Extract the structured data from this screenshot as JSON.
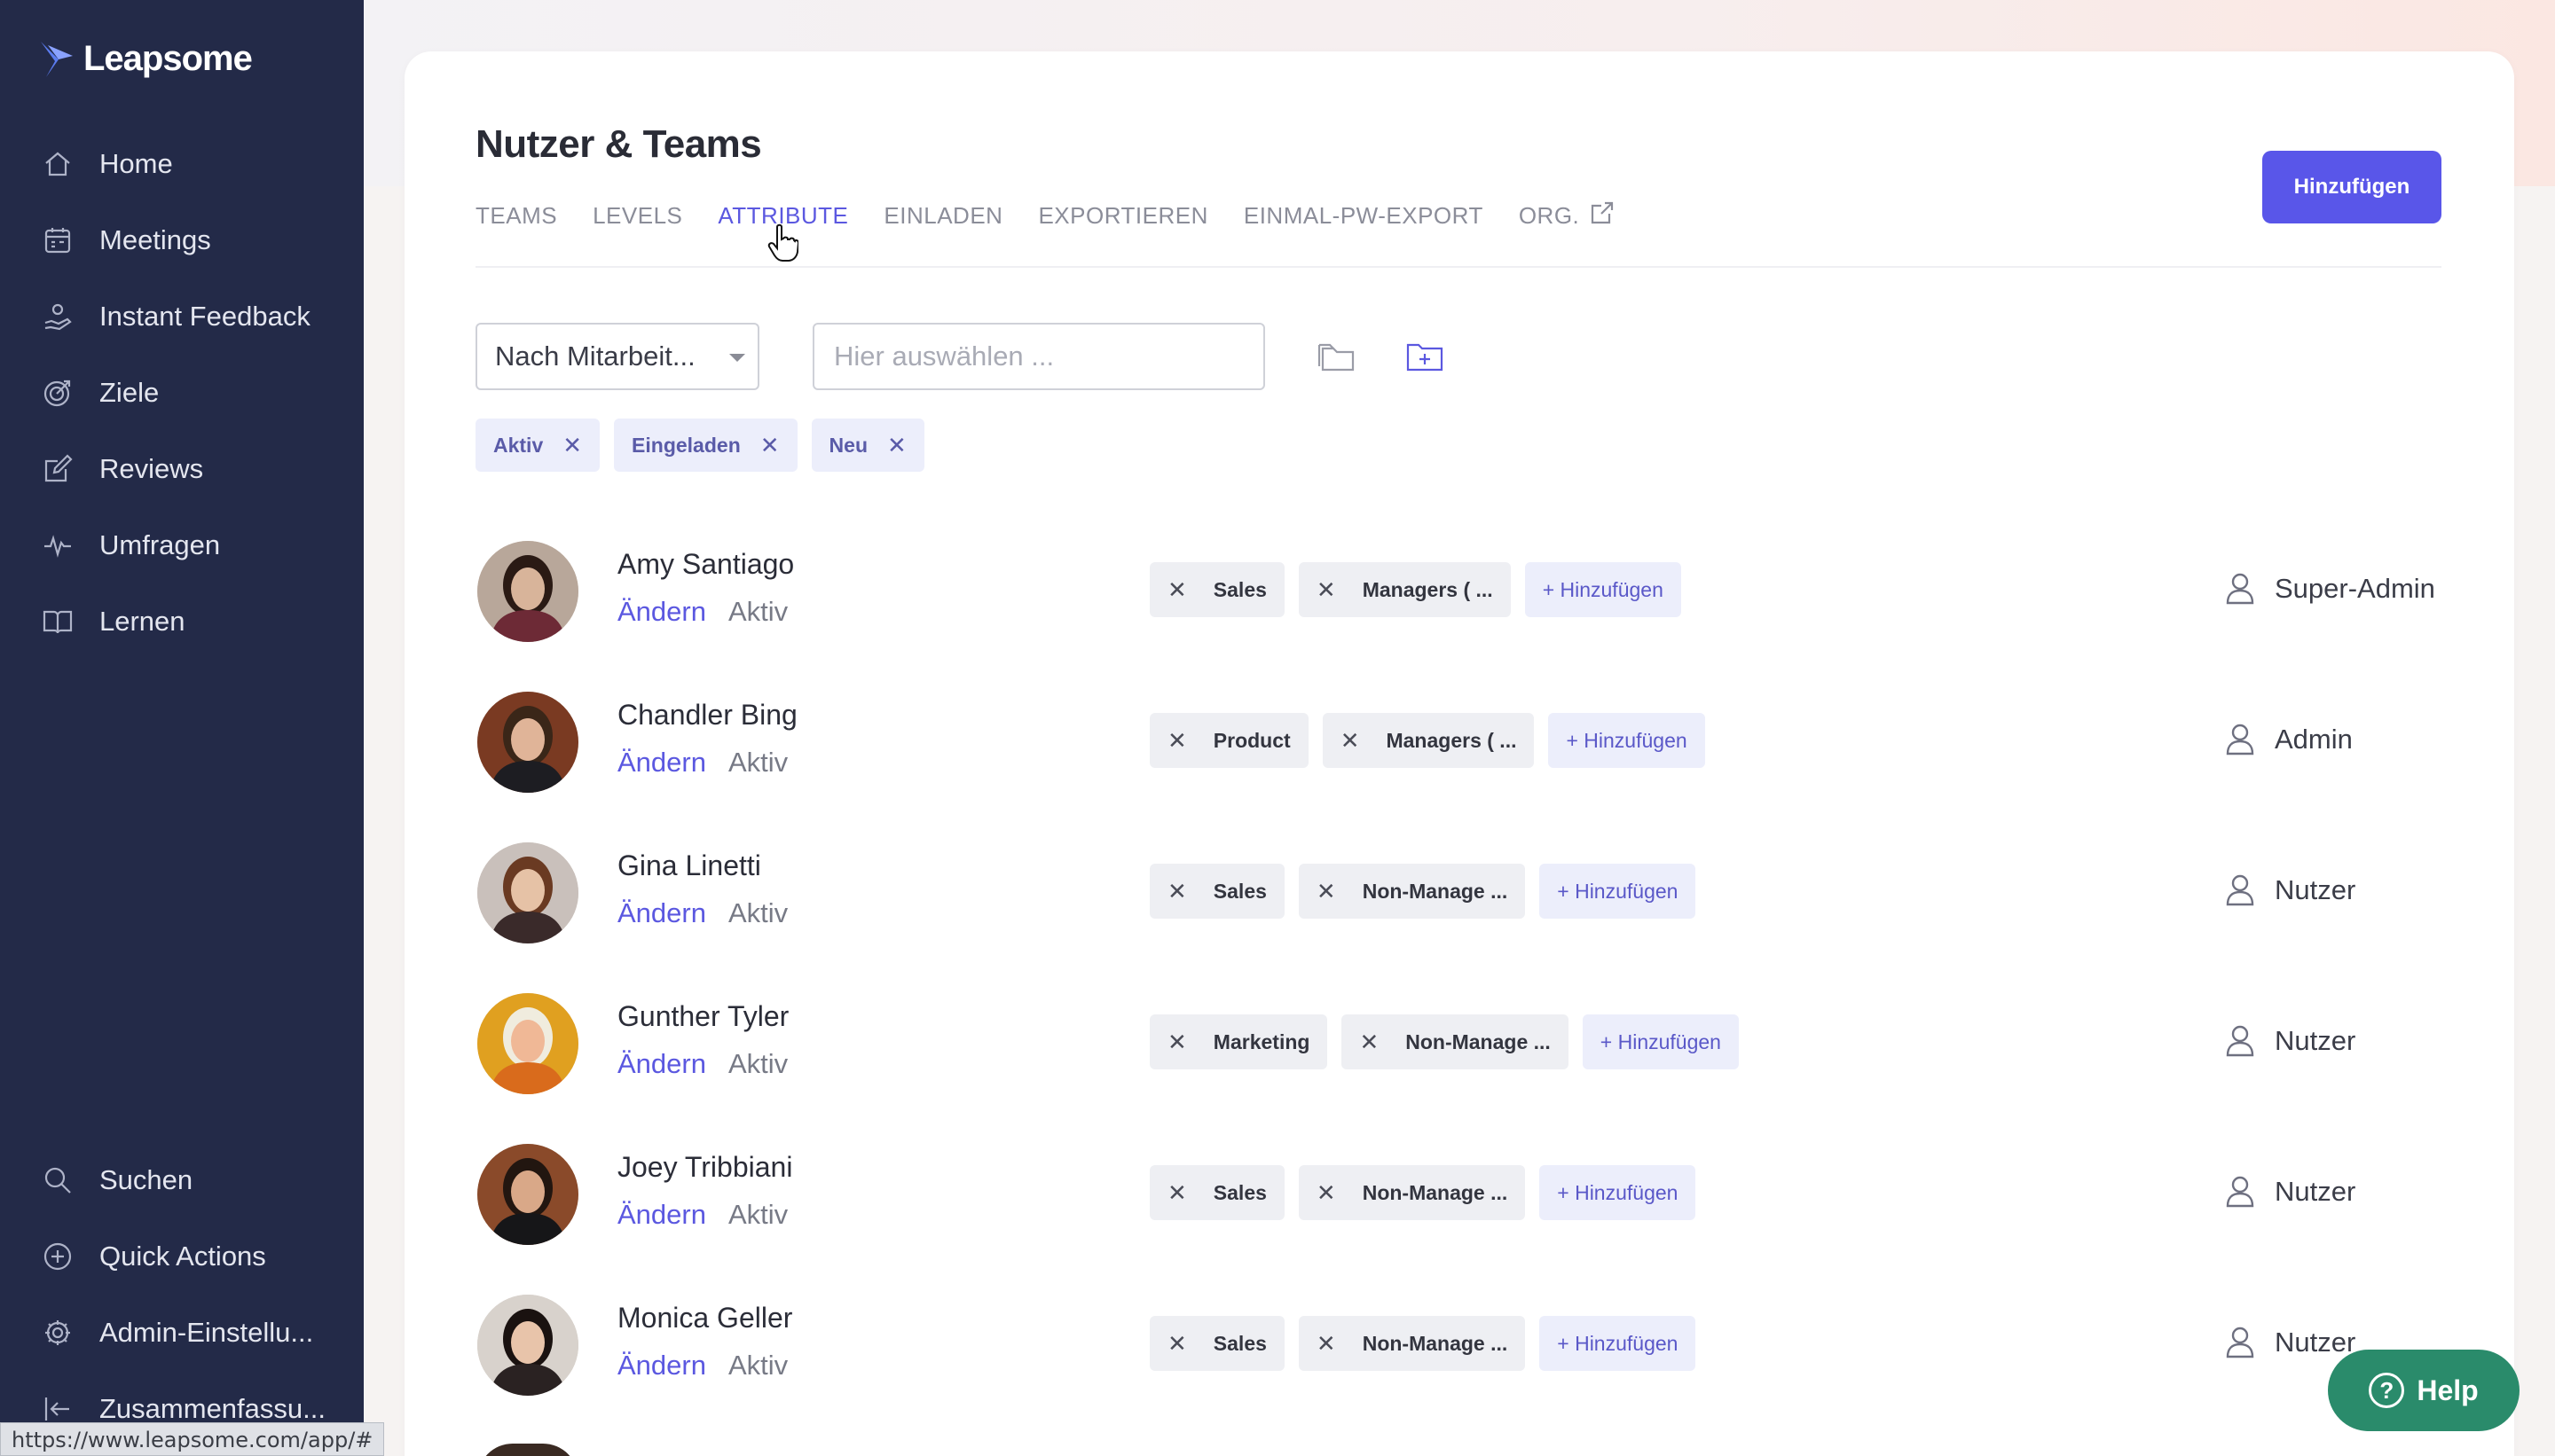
{
  "app": {
    "logo_text": "Leapsome",
    "status_url": "https://www.leapsome.com/app/#"
  },
  "sidebar": {
    "items": [
      {
        "label": "Home",
        "icon": "home-icon"
      },
      {
        "label": "Meetings",
        "icon": "calendar-icon"
      },
      {
        "label": "Instant Feedback",
        "icon": "feedback-hand-icon"
      },
      {
        "label": "Ziele",
        "icon": "target-icon"
      },
      {
        "label": "Reviews",
        "icon": "edit-square-icon"
      },
      {
        "label": "Umfragen",
        "icon": "pulse-icon"
      },
      {
        "label": "Lernen",
        "icon": "book-icon"
      }
    ],
    "bottom_items": [
      {
        "label": "Suchen",
        "icon": "search-icon"
      },
      {
        "label": "Quick Actions",
        "icon": "plus-circle-icon"
      },
      {
        "label": "Admin-Einstellu...",
        "icon": "gear-icon"
      },
      {
        "label": "Zusammenfassu...",
        "icon": "collapse-icon"
      }
    ]
  },
  "main": {
    "title": "Nutzer & Teams",
    "add_button": "Hinzufügen",
    "tabs": [
      {
        "label": "TEAMS",
        "active": false
      },
      {
        "label": "LEVELS",
        "active": false
      },
      {
        "label": "ATTRIBUTE",
        "active": true
      },
      {
        "label": "EINLADEN",
        "active": false
      },
      {
        "label": "EXPORTIEREN",
        "active": false
      },
      {
        "label": "EINMAL-PW-EXPORT",
        "active": false
      },
      {
        "label": "ORG.",
        "active": false,
        "icon": "external-link-icon"
      }
    ],
    "filter": {
      "select_value": "Nach Mitarbeit...",
      "search_placeholder": "Hier auswählen ..."
    },
    "chips": [
      "Aktiv",
      "Eingeladen",
      "Neu"
    ],
    "edit_label": "Ändern",
    "add_tag_label": "+ Hinzufügen",
    "users": [
      {
        "name": "Amy Santiago",
        "status": "Aktiv",
        "tags": [
          "Sales",
          "Managers ( ..."
        ],
        "role": "Super-Admin",
        "avatar_bg": "#b8a79a",
        "hair": "#2a1a14",
        "skin": "#d8b49a",
        "shirt": "#6d2a36"
      },
      {
        "name": "Chandler Bing",
        "status": "Aktiv",
        "tags": [
          "Product",
          "Managers ( ..."
        ],
        "role": "Admin",
        "avatar_bg": "#7a3a22",
        "hair": "#3a2618",
        "skin": "#e0b498",
        "shirt": "#1d1d22"
      },
      {
        "name": "Gina Linetti",
        "status": "Aktiv",
        "tags": [
          "Sales",
          "Non-Manage ..."
        ],
        "role": "Nutzer",
        "avatar_bg": "#c9c0bb",
        "hair": "#6a3a22",
        "skin": "#e6c2a6",
        "shirt": "#3a2a2a"
      },
      {
        "name": "Gunther Tyler",
        "status": "Aktiv",
        "tags": [
          "Marketing",
          "Non-Manage ..."
        ],
        "role": "Nutzer",
        "avatar_bg": "#e0a020",
        "hair": "#f0ecde",
        "skin": "#f0b896",
        "shirt": "#d96b1c"
      },
      {
        "name": "Joey Tribbiani",
        "status": "Aktiv",
        "tags": [
          "Sales",
          "Non-Manage ..."
        ],
        "role": "Nutzer",
        "avatar_bg": "#8a4a2a",
        "hair": "#221610",
        "skin": "#d9a888",
        "shirt": "#161618"
      },
      {
        "name": "Monica Geller",
        "status": "Aktiv",
        "tags": [
          "Sales",
          "Non-Manage ..."
        ],
        "role": "Nutzer",
        "avatar_bg": "#d8d2cc",
        "hair": "#1a1210",
        "skin": "#e8c4aa",
        "shirt": "#2a2222"
      }
    ]
  },
  "help": {
    "label": "Help",
    "q": "?"
  },
  "colors": {
    "sidebar": "#232a48",
    "accent": "#5956e9",
    "help": "#2a8b6b"
  }
}
